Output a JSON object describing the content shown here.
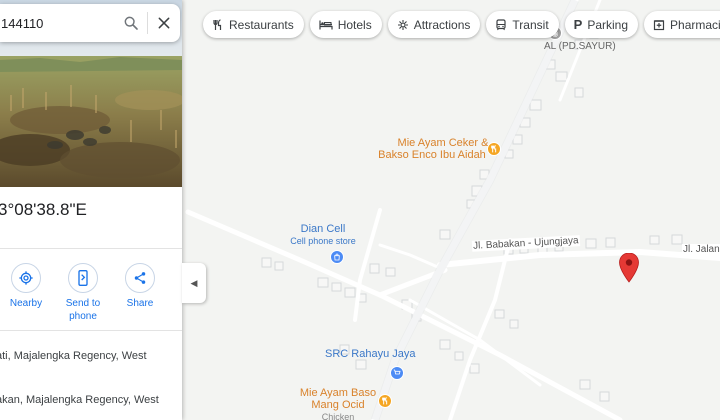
{
  "search": {
    "query_text": "144110",
    "search_icon": "search-icon",
    "close_icon": "close-icon"
  },
  "place": {
    "coordinates_text": "3°08'38.8\"E",
    "address_line_1": "ati, Majalengka Regency, West",
    "address_line_2": "akan, Majalengka Regency, West"
  },
  "actions": [
    {
      "label": "Nearby",
      "icon": "nearby-icon"
    },
    {
      "label": "Send to phone",
      "icon": "send-to-phone-icon"
    },
    {
      "label": "Share",
      "icon": "share-icon"
    }
  ],
  "chips": [
    {
      "label": "Restaurants",
      "icon": "restaurant-icon"
    },
    {
      "label": "Hotels",
      "icon": "hotel-icon"
    },
    {
      "label": "Attractions",
      "icon": "attractions-icon"
    },
    {
      "label": "Transit",
      "icon": "transit-icon"
    },
    {
      "label": "Parking",
      "icon": "parking-icon"
    },
    {
      "label": "Pharmacies",
      "icon": "pharmacy-icon"
    }
  ],
  "map": {
    "labels": {
      "al_pd_sayur": "AL (PD.SAYUR)",
      "mie_ayam_ceker_1": "Mie Ayam Ceker &",
      "mie_ayam_ceker_2": "Bakso Enco Ibu Aidah",
      "dian_cell": "Dian Cell",
      "dian_cell_sub": "Cell phone store",
      "road_babakan": "Jl. Babakan - Ujungjaya",
      "road_jalan": "Jl. Jalan",
      "src_rahayu": "SRC Rahayu Jaya",
      "mie_ayam_baso_1": "Mie Ayam Baso",
      "mie_ayam_baso_2": "Mang Ocid",
      "mie_ayam_baso_3": "Chicken"
    },
    "colors": {
      "food_poi": "#f5a623",
      "shop_poi": "#4c8bf5",
      "pin": "#e53935",
      "road": "#ffffff"
    }
  },
  "collapse_icon": "chevron-left-icon"
}
